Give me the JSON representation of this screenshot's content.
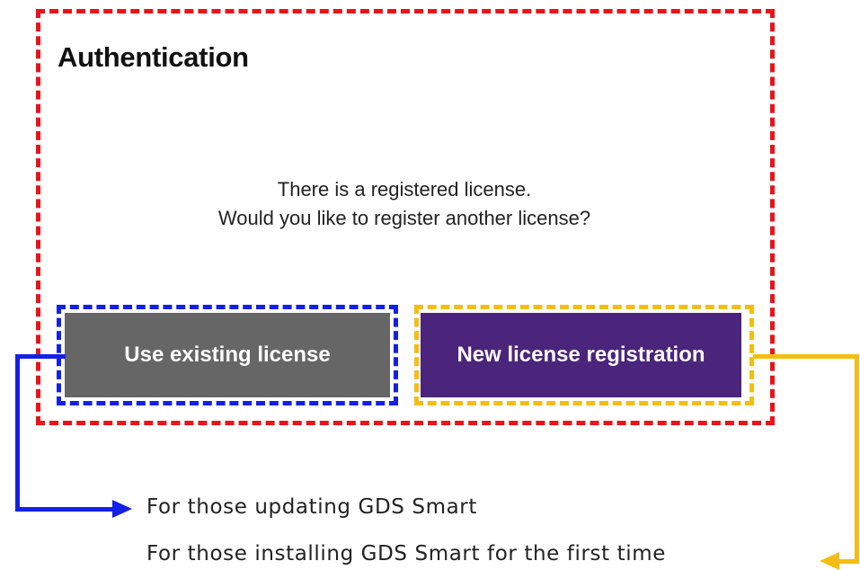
{
  "dialog": {
    "title": "Authentication",
    "message_line1": "There is a registered license.",
    "message_line2": "Would you like to register another license?",
    "buttons": {
      "existing_label": "Use existing license",
      "new_label": "New license registration"
    }
  },
  "annotations": {
    "existing_caption": "For those updating GDS Smart",
    "new_caption": "For those installing GDS Smart for the first time"
  },
  "colors": {
    "dialog_outline": "#e8141b",
    "existing_outline": "#1420e6",
    "new_outline": "#f5bd12",
    "existing_button": "#666666",
    "new_button": "#4b247b"
  }
}
